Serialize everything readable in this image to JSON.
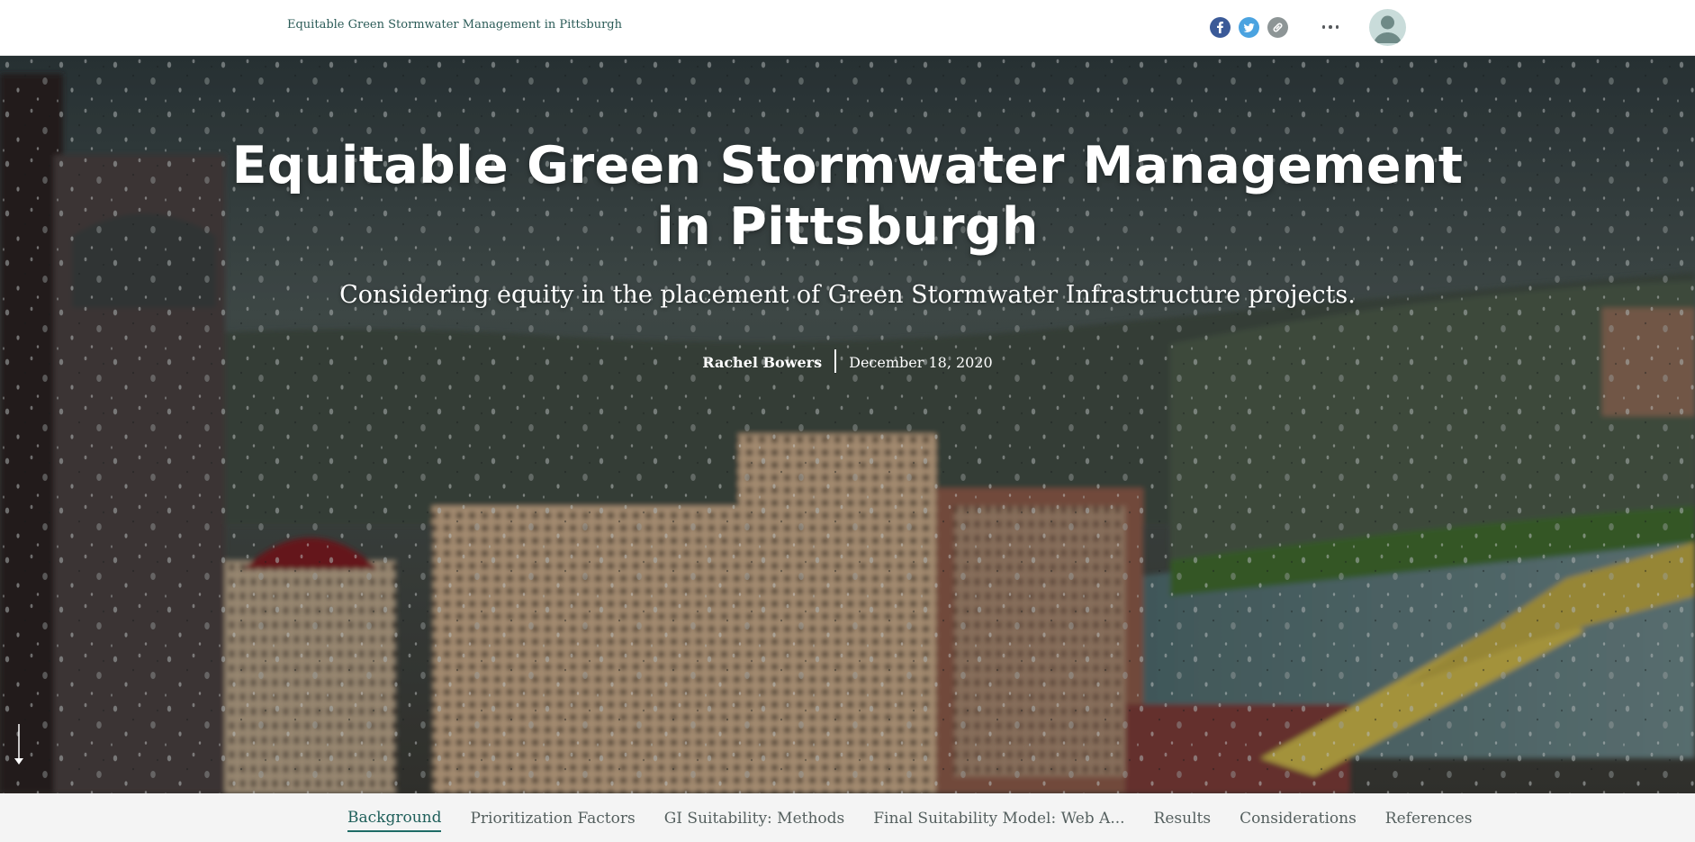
{
  "header": {
    "story_title": "Equitable Green Stormwater Management in Pittsburgh",
    "share_icons": [
      "facebook-icon",
      "twitter-icon",
      "link-icon"
    ],
    "more_icon": "ellipsis-icon",
    "avatar_icon": "user-avatar-icon"
  },
  "hero": {
    "title": "Equitable Green Stormwater Management in Pittsburgh",
    "subtitle": "Considering equity in the placement of Green Stormwater Infrastructure projects.",
    "author": "Rachel Bowers",
    "date": "December 18, 2020",
    "scroll_icon": "arrow-down-icon"
  },
  "nav": {
    "items": [
      {
        "label": "Background",
        "active": true
      },
      {
        "label": "Prioritization Factors",
        "active": false
      },
      {
        "label": "GI Suitability: Methods",
        "active": false
      },
      {
        "label": "Final Suitability Model: Web A...",
        "active": false
      },
      {
        "label": "Results",
        "active": false
      },
      {
        "label": "Considerations",
        "active": false
      },
      {
        "label": "References",
        "active": false
      }
    ]
  },
  "colors": {
    "header_title": "#2b5b57",
    "facebook": "#3b5a98",
    "twitter": "#4ba3e0",
    "link": "#8d9596",
    "nav_active": "#1f6b66",
    "nav_bg": "#f4f4f4"
  }
}
